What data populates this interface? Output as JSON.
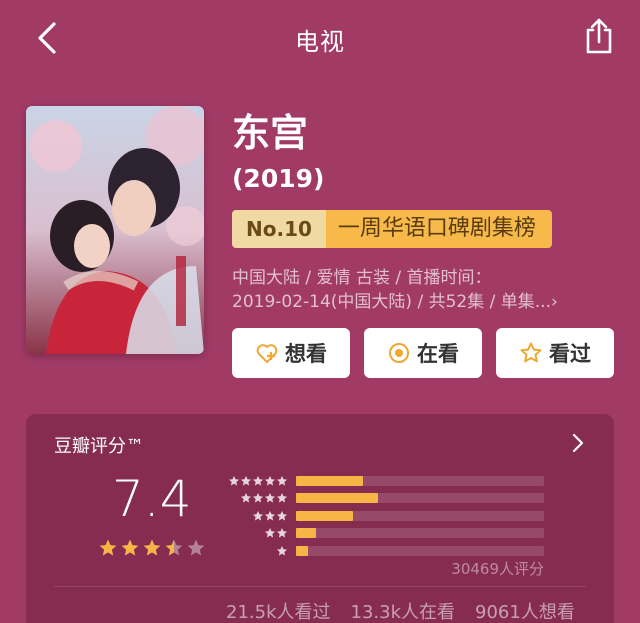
{
  "header": {
    "title": "电视"
  },
  "show": {
    "title": "东宫",
    "year": "(2019)",
    "rank": {
      "no": "No.10",
      "name": "一周华语口碑剧集榜"
    },
    "meta_line1": "中国大陆 / 爱情 古装 / 首播时间：",
    "meta_line2": "2019-02-14(中国大陆) / 共52集 / 单集...›"
  },
  "actions": [
    {
      "label": "想看",
      "icon": "heart-plus-icon"
    },
    {
      "label": "在看",
      "icon": "target-icon"
    },
    {
      "label": "看过",
      "icon": "star-outline-icon"
    }
  ],
  "rating": {
    "title": "豆瓣评分™",
    "score": "7.4",
    "stars": 3.5,
    "distribution": [
      {
        "stars": 5,
        "fraction": 0.27
      },
      {
        "stars": 4,
        "fraction": 0.33
      },
      {
        "stars": 3,
        "fraction": 0.23
      },
      {
        "stars": 2,
        "fraction": 0.08
      },
      {
        "stars": 1,
        "fraction": 0.05
      }
    ],
    "count": "30469人评分",
    "stats": {
      "watched": "21.5k人看过",
      "watching": "13.3k人在看",
      "want": "9061人想看"
    }
  },
  "colors": {
    "background": "#a23a66",
    "accent": "#f6b545"
  }
}
